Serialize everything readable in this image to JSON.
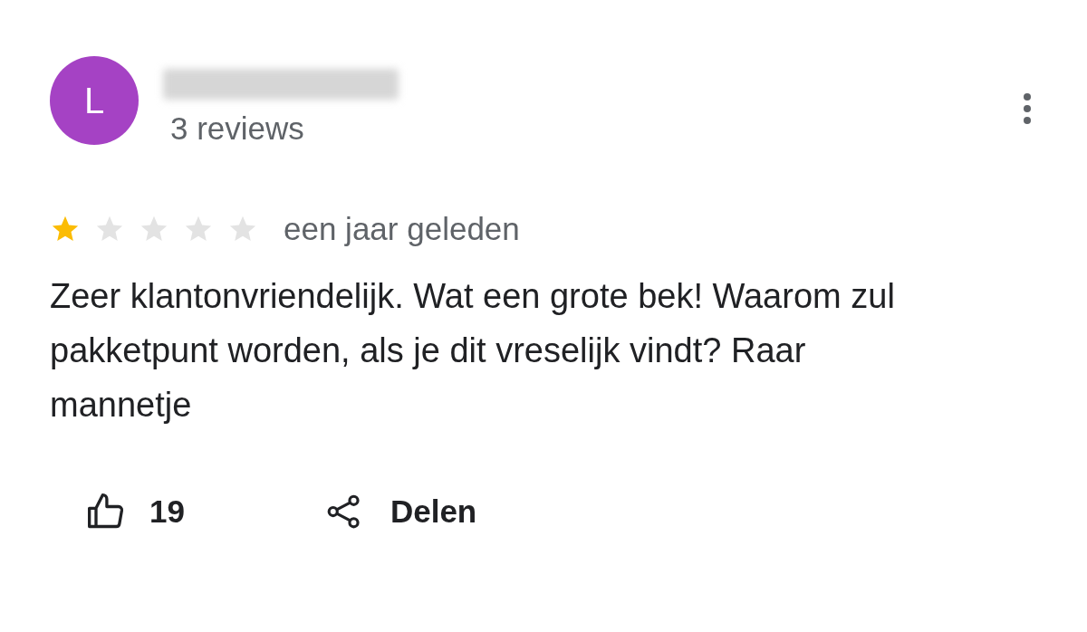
{
  "reviewer": {
    "avatar_letter": "L",
    "reviews": "3 reviews"
  },
  "review": {
    "stars": 1,
    "time": "een jaar geleden",
    "text": "Zeer klantonvriendelijk. Wat een grote bek! Waarom zul pakketpunt worden, als je dit vreselijk vindt? Raar mannetje"
  },
  "actions": {
    "likes": "19",
    "share": "Delen"
  }
}
